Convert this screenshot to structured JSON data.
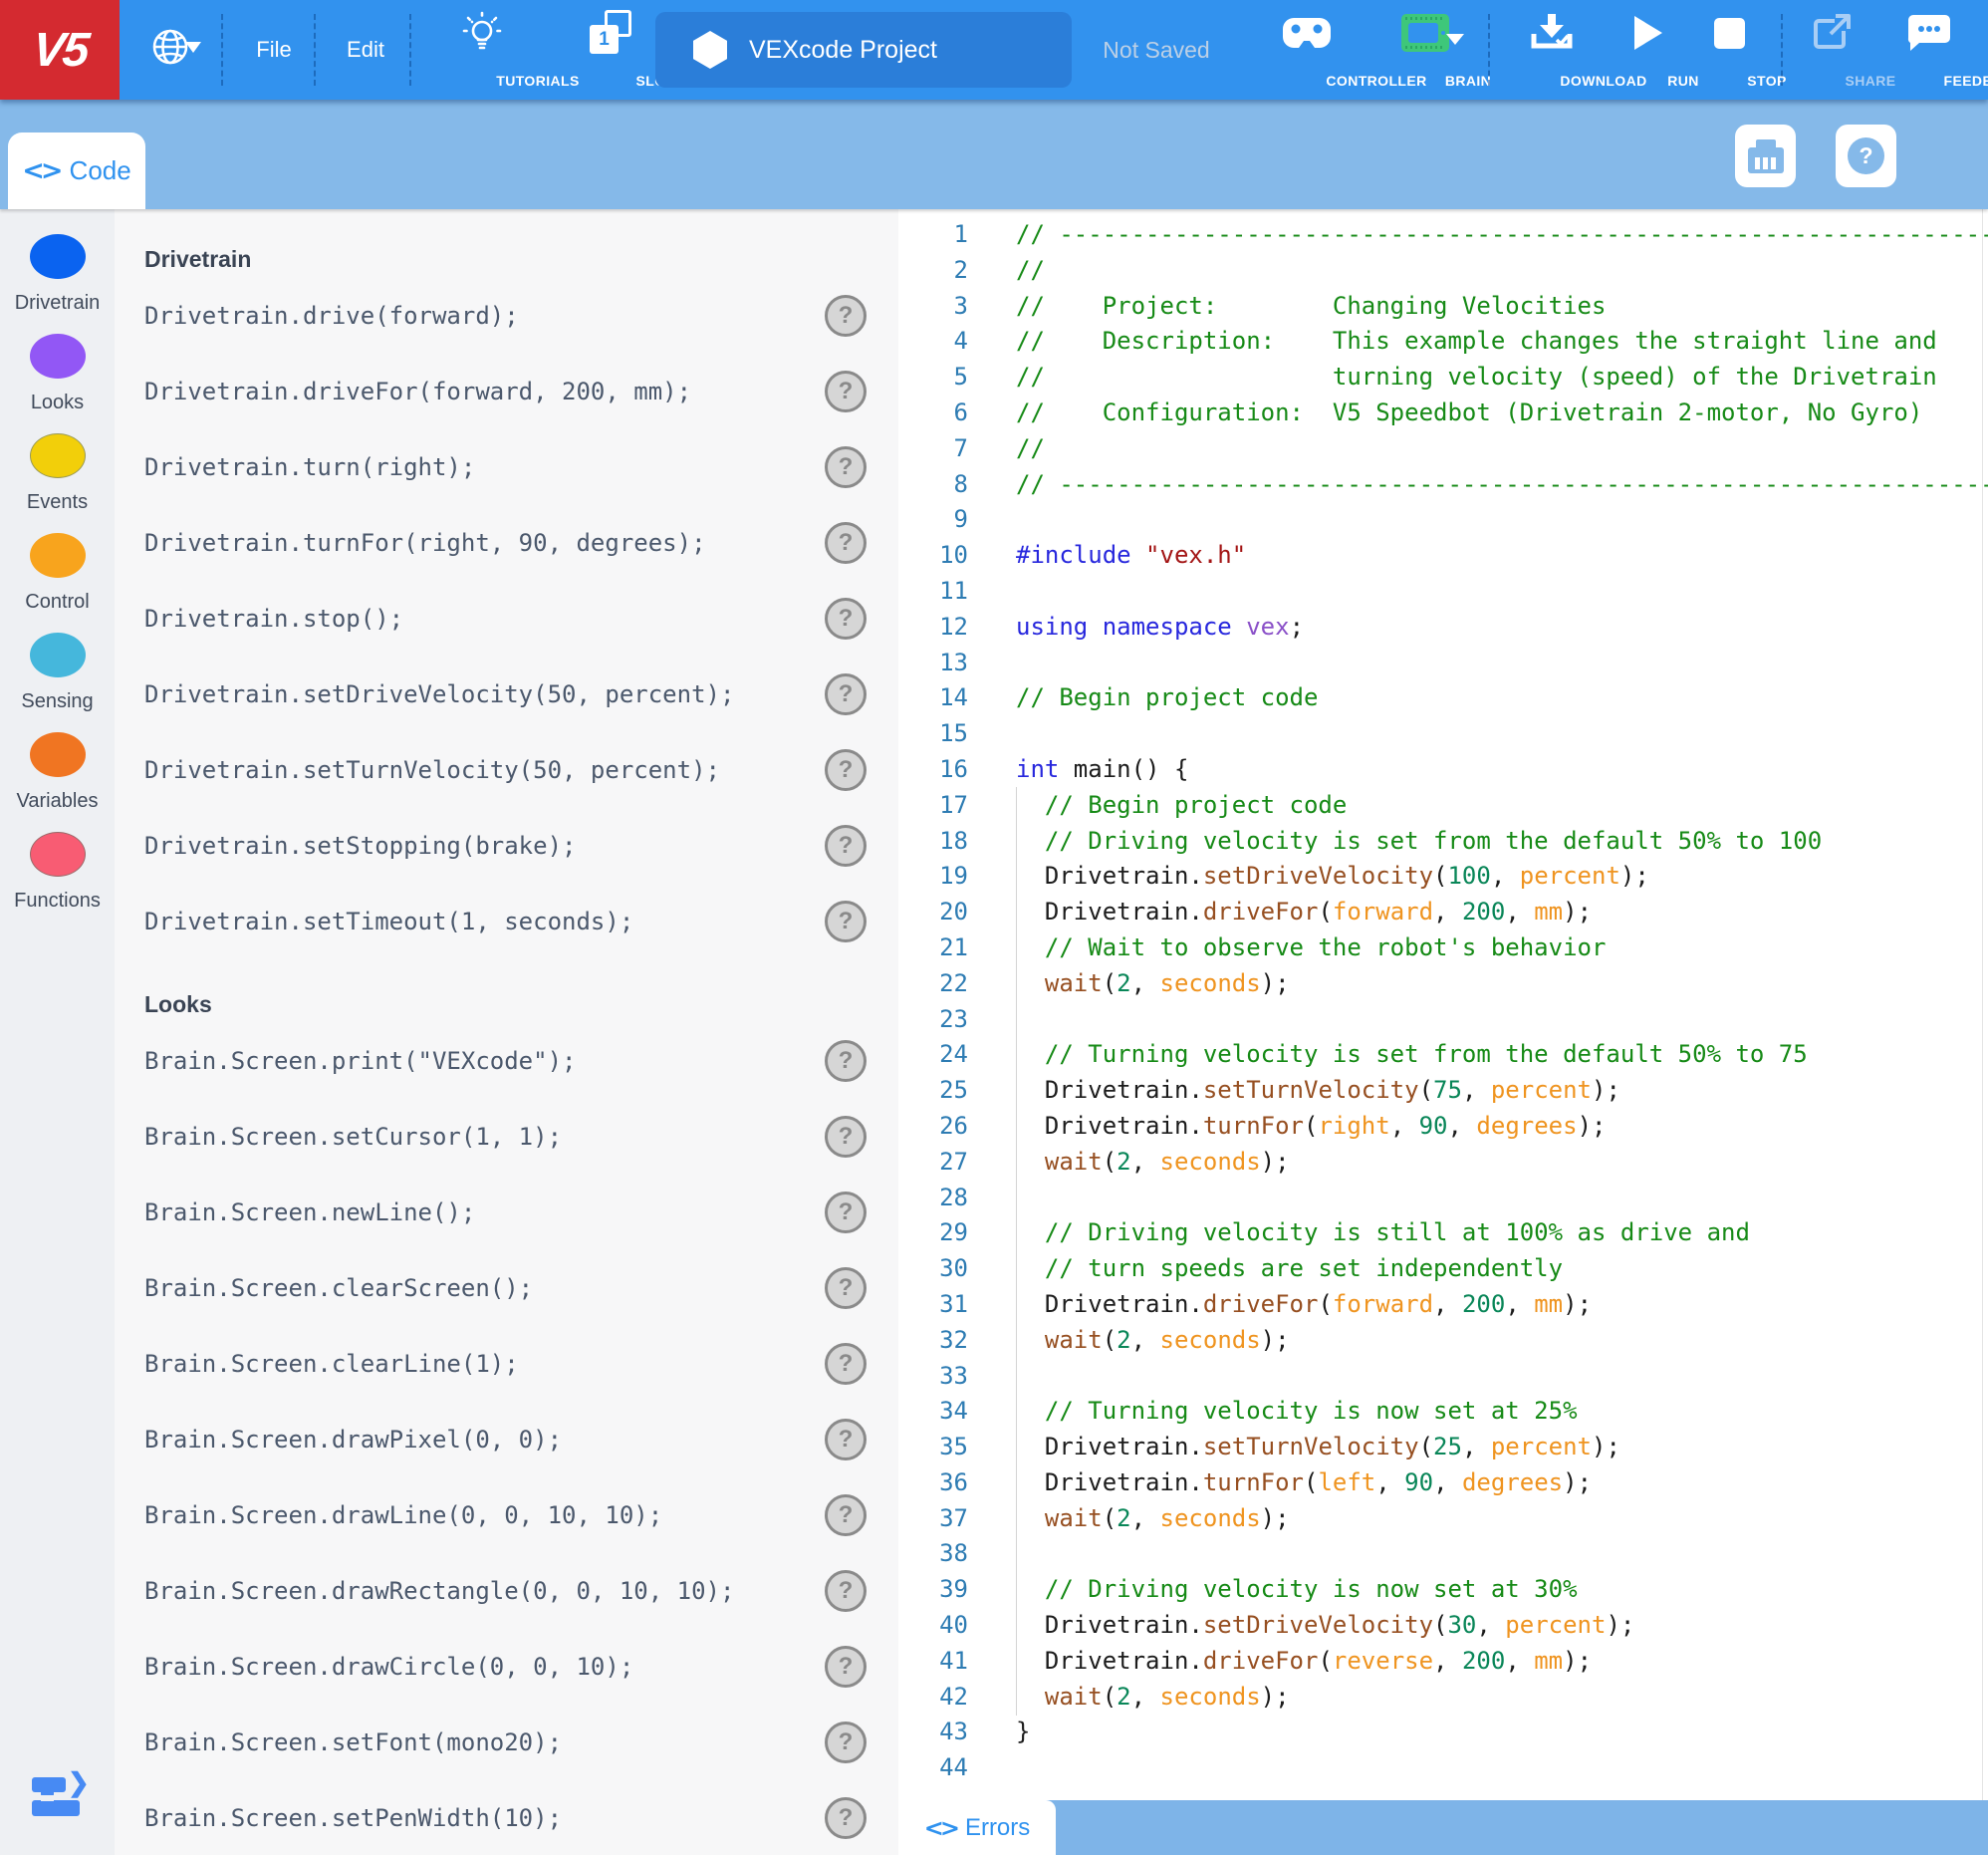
{
  "topbar": {
    "logo_text": "V5",
    "file_label": "File",
    "edit_label": "Edit",
    "tutorials_label": "TUTORIALS",
    "slot_label": "SLOT",
    "slot_number": "1",
    "project_name": "VEXcode Project",
    "save_status": "Not Saved",
    "controller_label": "CONTROLLER",
    "brain_label": "BRAIN",
    "download_label": "DOWNLOAD",
    "run_label": "RUN",
    "stop_label": "STOP",
    "share_label": "SHARE",
    "feedback_label": "FEEDBACK",
    "icons": [
      "globe-icon",
      "lightbulb-icon",
      "slot-pages-icon",
      "hexagon-icon",
      "gamepad-icon",
      "brain-screen-icon",
      "download-icon",
      "play-icon",
      "stop-square-icon",
      "share-icon",
      "speech-bubble-icon"
    ]
  },
  "tabbar": {
    "code_tab_label": "Code",
    "angle_glyph": "<>",
    "help_glyph": "?"
  },
  "sidebar": {
    "categories": [
      {
        "label": "Drivetrain",
        "color": "#0a63f0",
        "border": "none"
      },
      {
        "label": "Looks",
        "color": "#9257f5",
        "border": "none"
      },
      {
        "label": "Events",
        "color": "#f2cf0a",
        "border": "1px solid #9a9a55"
      },
      {
        "label": "Control",
        "color": "#f8a41d",
        "border": "none"
      },
      {
        "label": "Sensing",
        "color": "#45b7dc",
        "border": "none"
      },
      {
        "label": "Variables",
        "color": "#f07522",
        "border": "none"
      },
      {
        "label": "Functions",
        "color": "#f85c73",
        "border": "1px solid #9a6a6a"
      }
    ]
  },
  "palette": {
    "sections": [
      {
        "title": "Drivetrain",
        "commands": [
          "Drivetrain.drive(forward);",
          "Drivetrain.driveFor(forward, 200, mm);",
          "Drivetrain.turn(right);",
          "Drivetrain.turnFor(right, 90, degrees);",
          "Drivetrain.stop();",
          "Drivetrain.setDriveVelocity(50, percent);",
          "Drivetrain.setTurnVelocity(50, percent);",
          "Drivetrain.setStopping(brake);",
          "Drivetrain.setTimeout(1, seconds);"
        ]
      },
      {
        "title": "Looks",
        "commands": [
          "Brain.Screen.print(\"VEXcode\");",
          "Brain.Screen.setCursor(1, 1);",
          "Brain.Screen.newLine();",
          "Brain.Screen.clearScreen();",
          "Brain.Screen.clearLine(1);",
          "Brain.Screen.drawPixel(0, 0);",
          "Brain.Screen.drawLine(0, 0, 10, 10);",
          "Brain.Screen.drawRectangle(0, 0, 10, 10);",
          "Brain.Screen.drawCircle(0, 0, 10);",
          "Brain.Screen.setFont(mono20);",
          "Brain.Screen.setPenWidth(10);"
        ]
      }
    ],
    "help_glyph": "?"
  },
  "editor": {
    "lines": [
      [
        [
          "c",
          "// ----------------------------------------------------------------------"
        ]
      ],
      [
        [
          "c",
          "//"
        ]
      ],
      [
        [
          "c",
          "//    Project:        Changing Velocities"
        ]
      ],
      [
        [
          "c",
          "//    Description:    This example changes the straight line and"
        ]
      ],
      [
        [
          "c",
          "//                    turning velocity (speed) of the Drivetrain"
        ]
      ],
      [
        [
          "c",
          "//    Configuration:  V5 Speedbot (Drivetrain 2-motor, No Gyro)"
        ]
      ],
      [
        [
          "c",
          "//"
        ]
      ],
      [
        [
          "c",
          "// ----------------------------------------------------------------------"
        ]
      ],
      [],
      [
        [
          "k",
          "#include"
        ],
        [
          "p",
          " "
        ],
        [
          "s",
          "\"vex.h\""
        ]
      ],
      [],
      [
        [
          "k",
          "using"
        ],
        [
          "p",
          " "
        ],
        [
          "k",
          "namespace"
        ],
        [
          "p",
          " "
        ],
        [
          "n",
          "vex"
        ],
        [
          "p",
          ";"
        ]
      ],
      [],
      [
        [
          "c",
          "// Begin project code"
        ]
      ],
      [],
      [
        [
          "k",
          "int"
        ],
        [
          "p",
          " main() {"
        ]
      ],
      [
        [
          "c",
          "  // Begin project code"
        ]
      ],
      [
        [
          "c",
          "  // Driving velocity is set from the default 50% to 100"
        ]
      ],
      [
        [
          "p",
          "  Drivetrain."
        ],
        [
          "f",
          "setDriveVelocity"
        ],
        [
          "p",
          "("
        ],
        [
          "d",
          "100"
        ],
        [
          "p",
          ", "
        ],
        [
          "e",
          "percent"
        ],
        [
          "p",
          ");"
        ]
      ],
      [
        [
          "p",
          "  Drivetrain."
        ],
        [
          "f",
          "driveFor"
        ],
        [
          "p",
          "("
        ],
        [
          "e",
          "forward"
        ],
        [
          "p",
          ", "
        ],
        [
          "d",
          "200"
        ],
        [
          "p",
          ", "
        ],
        [
          "e",
          "mm"
        ],
        [
          "p",
          ");"
        ]
      ],
      [
        [
          "c",
          "  // Wait to observe the robot's behavior"
        ]
      ],
      [
        [
          "p",
          "  "
        ],
        [
          "f",
          "wait"
        ],
        [
          "p",
          "("
        ],
        [
          "d",
          "2"
        ],
        [
          "p",
          ", "
        ],
        [
          "e",
          "seconds"
        ],
        [
          "p",
          ");"
        ]
      ],
      [],
      [
        [
          "c",
          "  // Turning velocity is set from the default 50% to 75"
        ]
      ],
      [
        [
          "p",
          "  Drivetrain."
        ],
        [
          "f",
          "setTurnVelocity"
        ],
        [
          "p",
          "("
        ],
        [
          "d",
          "75"
        ],
        [
          "p",
          ", "
        ],
        [
          "e",
          "percent"
        ],
        [
          "p",
          ");"
        ]
      ],
      [
        [
          "p",
          "  Drivetrain."
        ],
        [
          "f",
          "turnFor"
        ],
        [
          "p",
          "("
        ],
        [
          "e",
          "right"
        ],
        [
          "p",
          ", "
        ],
        [
          "d",
          "90"
        ],
        [
          "p",
          ", "
        ],
        [
          "e",
          "degrees"
        ],
        [
          "p",
          ");"
        ]
      ],
      [
        [
          "p",
          "  "
        ],
        [
          "f",
          "wait"
        ],
        [
          "p",
          "("
        ],
        [
          "d",
          "2"
        ],
        [
          "p",
          ", "
        ],
        [
          "e",
          "seconds"
        ],
        [
          "p",
          ");"
        ]
      ],
      [],
      [
        [
          "c",
          "  // Driving velocity is still at 100% as drive and"
        ]
      ],
      [
        [
          "c",
          "  // turn speeds are set independently"
        ]
      ],
      [
        [
          "p",
          "  Drivetrain."
        ],
        [
          "f",
          "driveFor"
        ],
        [
          "p",
          "("
        ],
        [
          "e",
          "forward"
        ],
        [
          "p",
          ", "
        ],
        [
          "d",
          "200"
        ],
        [
          "p",
          ", "
        ],
        [
          "e",
          "mm"
        ],
        [
          "p",
          ");"
        ]
      ],
      [
        [
          "p",
          "  "
        ],
        [
          "f",
          "wait"
        ],
        [
          "p",
          "("
        ],
        [
          "d",
          "2"
        ],
        [
          "p",
          ", "
        ],
        [
          "e",
          "seconds"
        ],
        [
          "p",
          ");"
        ]
      ],
      [],
      [
        [
          "c",
          "  // Turning velocity is now set at 25%"
        ]
      ],
      [
        [
          "p",
          "  Drivetrain."
        ],
        [
          "f",
          "setTurnVelocity"
        ],
        [
          "p",
          "("
        ],
        [
          "d",
          "25"
        ],
        [
          "p",
          ", "
        ],
        [
          "e",
          "percent"
        ],
        [
          "p",
          ");"
        ]
      ],
      [
        [
          "p",
          "  Drivetrain."
        ],
        [
          "f",
          "turnFor"
        ],
        [
          "p",
          "("
        ],
        [
          "e",
          "left"
        ],
        [
          "p",
          ", "
        ],
        [
          "d",
          "90"
        ],
        [
          "p",
          ", "
        ],
        [
          "e",
          "degrees"
        ],
        [
          "p",
          ");"
        ]
      ],
      [
        [
          "p",
          "  "
        ],
        [
          "f",
          "wait"
        ],
        [
          "p",
          "("
        ],
        [
          "d",
          "2"
        ],
        [
          "p",
          ", "
        ],
        [
          "e",
          "seconds"
        ],
        [
          "p",
          ");"
        ]
      ],
      [],
      [
        [
          "c",
          "  // Driving velocity is now set at 30%"
        ]
      ],
      [
        [
          "p",
          "  Drivetrain."
        ],
        [
          "f",
          "setDriveVelocity"
        ],
        [
          "p",
          "("
        ],
        [
          "d",
          "30"
        ],
        [
          "p",
          ", "
        ],
        [
          "e",
          "percent"
        ],
        [
          "p",
          ");"
        ]
      ],
      [
        [
          "p",
          "  Drivetrain."
        ],
        [
          "f",
          "driveFor"
        ],
        [
          "p",
          "("
        ],
        [
          "e",
          "reverse"
        ],
        [
          "p",
          ", "
        ],
        [
          "d",
          "200"
        ],
        [
          "p",
          ", "
        ],
        [
          "e",
          "mm"
        ],
        [
          "p",
          ");"
        ]
      ],
      [
        [
          "p",
          "  "
        ],
        [
          "f",
          "wait"
        ],
        [
          "p",
          "("
        ],
        [
          "d",
          "2"
        ],
        [
          "p",
          ", "
        ],
        [
          "e",
          "seconds"
        ],
        [
          "p",
          ");"
        ]
      ],
      [
        [
          "p",
          "}"
        ]
      ],
      []
    ]
  },
  "statusbar": {
    "errors_tab_label": "Errors",
    "angle_glyph": "<>"
  },
  "colors": {
    "topbar_blue": "#3292ee",
    "brand_red": "#d42a30",
    "tabbar_blue": "#85b9e9",
    "brain_green": "#3ec77a",
    "accent_blue": "#2f92ef",
    "syntax_comment": "#168a16",
    "syntax_keyword": "#2727dd",
    "syntax_string": "#a31515",
    "syntax_namespace": "#8a50c8",
    "syntax_function": "#964f21",
    "syntax_number": "#098658",
    "syntax_enum": "#ef9420",
    "line_number": "#2e7cb3"
  }
}
